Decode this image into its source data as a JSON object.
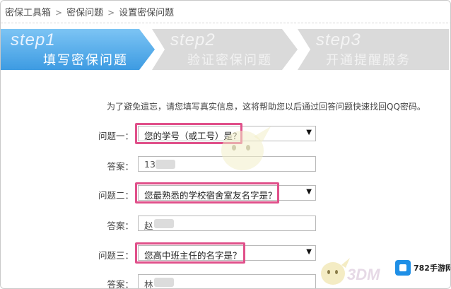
{
  "breadcrumb": {
    "items": [
      "密保工具箱",
      "密保问题",
      "设置密保问题"
    ]
  },
  "steps": [
    {
      "num": "step1",
      "title": "填写密保问题",
      "state": "active"
    },
    {
      "num": "step2",
      "title": "验证密保问题",
      "state": "inactive"
    },
    {
      "num": "step3",
      "title": "开通提醒服务",
      "state": "inactive"
    }
  ],
  "form": {
    "intro": "为了避免遗忘，请您填写真实信息，这将帮助您以后通过回答问题快速找回QQ密码。",
    "questions": [
      {
        "label": "问题一：",
        "selected": "您的学号（或工号）是？",
        "answer_label": "答案：",
        "answer": "13"
      },
      {
        "label": "问题二：",
        "selected": "您最熟悉的学校宿舍室友名字是？",
        "answer_label": "答案：",
        "answer": "赵"
      },
      {
        "label": "问题三：",
        "selected": "您高中班主任的名字是？",
        "answer_label": "答案：",
        "answer": "林"
      }
    ]
  },
  "watermarks": {
    "brand": "3DM",
    "site": "782手游网"
  },
  "colors": {
    "step_active": "#4aa8ea",
    "step_inactive": "#d9d9d9",
    "highlight": "#e0508a"
  }
}
